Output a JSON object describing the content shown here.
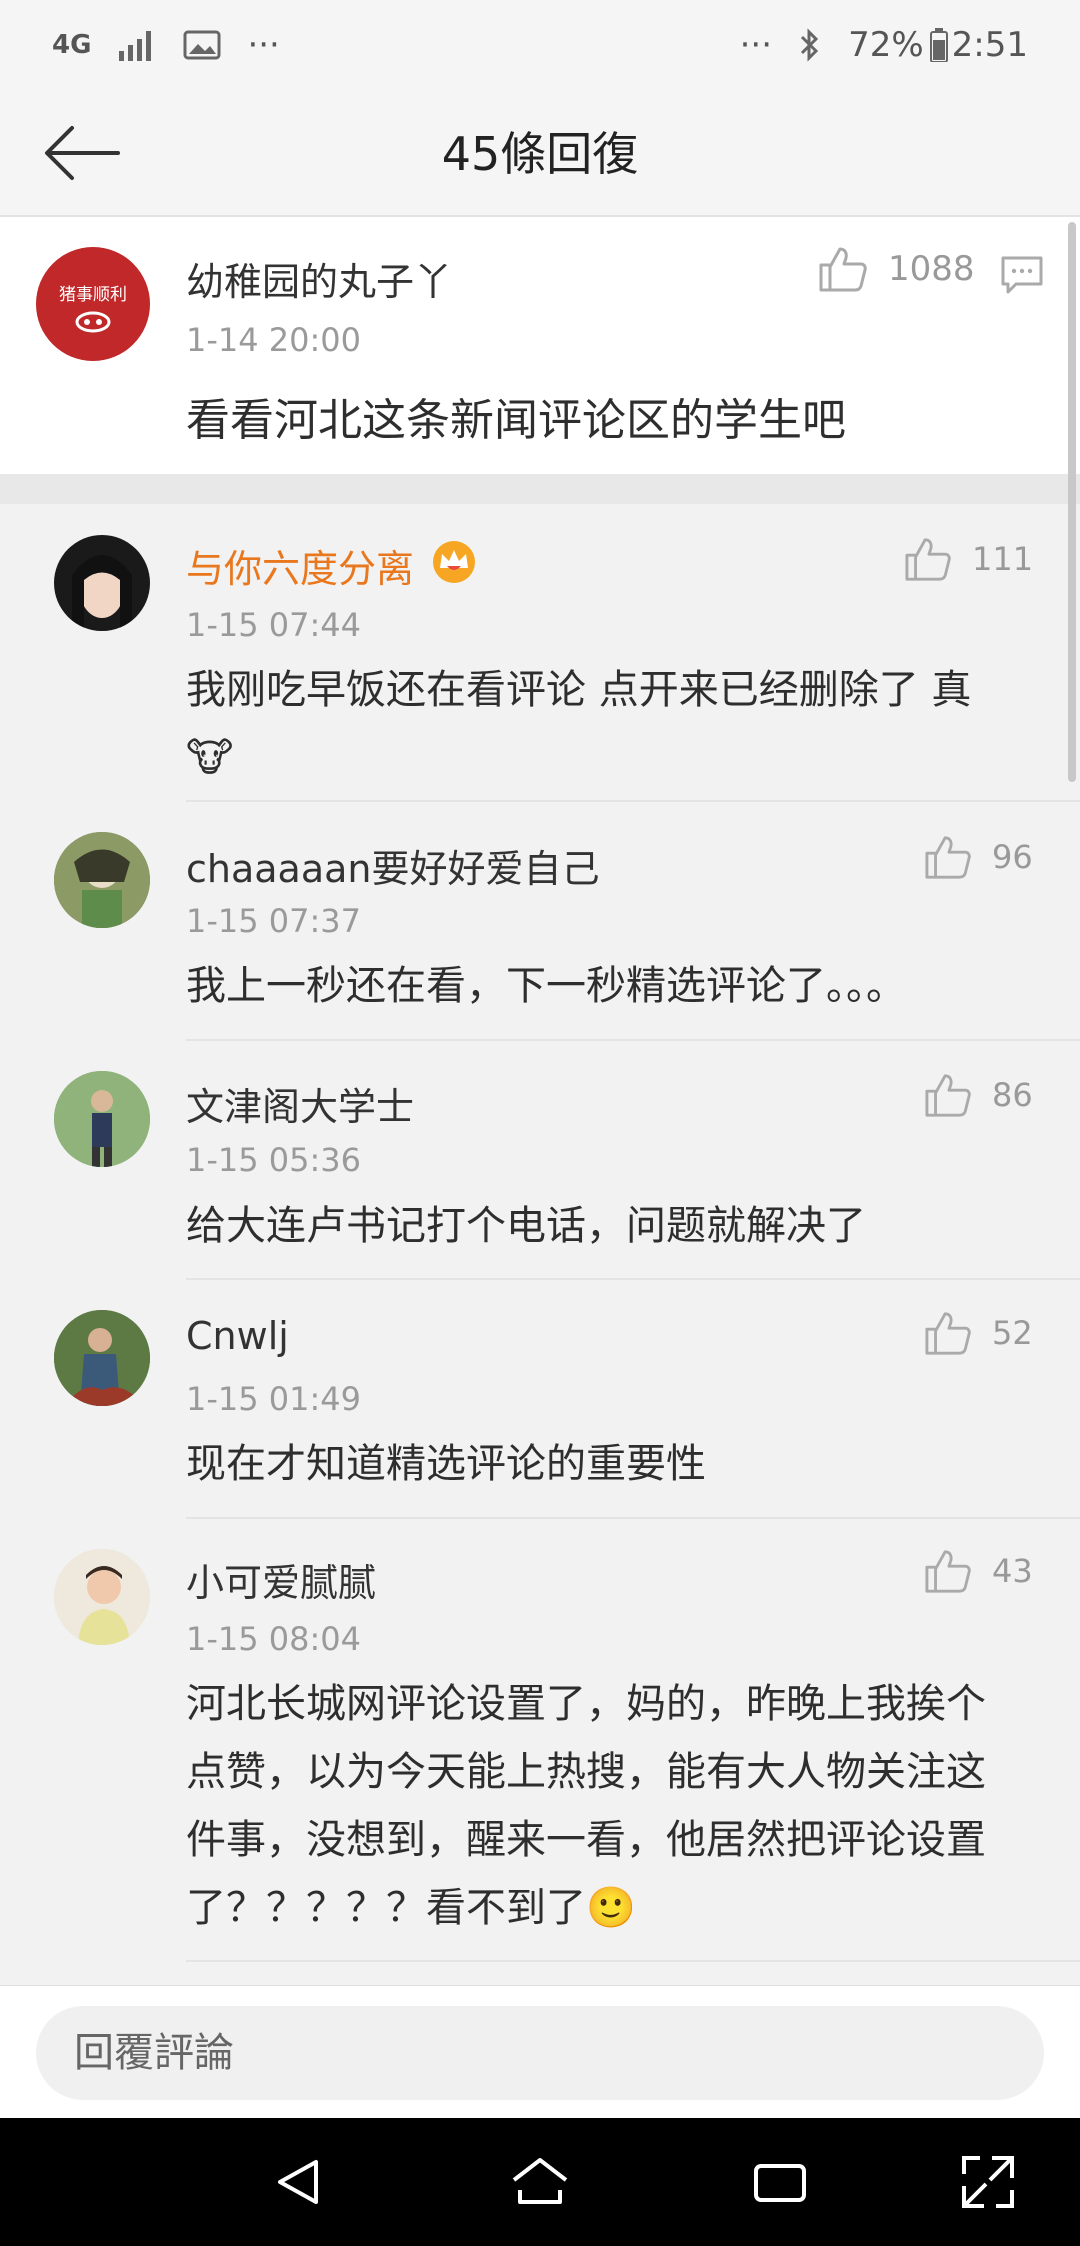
{
  "status_bar": {
    "network": "4G",
    "more_left": "···",
    "more_right": "···",
    "battery": "72%",
    "time": "2:51"
  },
  "header": {
    "title": "45條回復"
  },
  "root_comment": {
    "name": "幼稚园的丸子丫",
    "time": "1-14 20:00",
    "likes": "1088",
    "text": "看看河北这条新闻评论区的学生吧",
    "avatar_text": "猪事顺利"
  },
  "replies": [
    {
      "name": "与你六度分离",
      "time": "1-15 07:44",
      "likes": "111",
      "text": "我刚吃早饭还在看评论 点开来已经删除了 真",
      "emoji": "🐮"
    },
    {
      "name": "chaaaaan要好好爱自己",
      "time": "1-15 07:37",
      "likes": "96",
      "text": "我上一秒还在看，下一秒精选评论了。。。"
    },
    {
      "name": "文津阁大学士",
      "time": "1-15 05:36",
      "likes": "86",
      "text": "给大连卢书记打个电话，问题就解决了"
    },
    {
      "name": "Cnwlj",
      "time": "1-15 01:49",
      "likes": "52",
      "text": "现在才知道精选评论的重要性"
    },
    {
      "name": "小可爱腻腻",
      "time": "1-15 08:04",
      "likes": "43",
      "lines": [
        "河北长城网评论设置了，妈的，昨晚上我挨个",
        "点赞，以为今天能上热搜，能有大人物关注这",
        "件事，没想到，醒来一看，他居然把评论设置",
        "了？？？？？看不到了"
      ],
      "emoji": "🙂"
    }
  ],
  "reply_bar": {
    "placeholder": "回覆評論"
  },
  "colors": {
    "vip_name": "#e8771e",
    "accent_red": "#c0282a"
  }
}
